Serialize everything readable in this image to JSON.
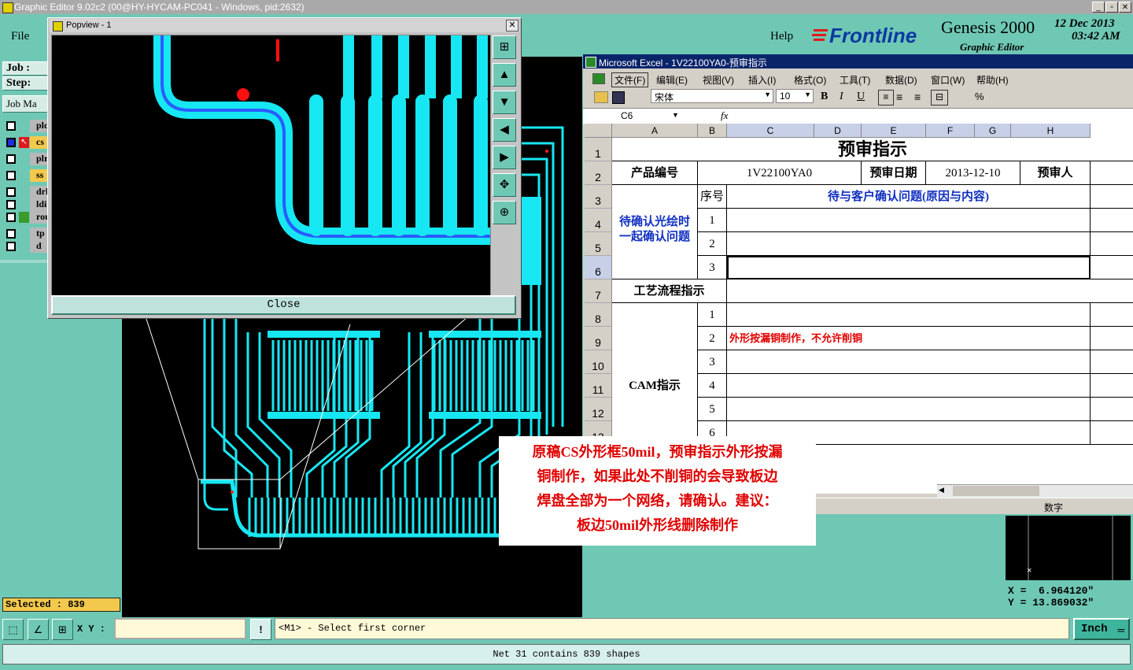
{
  "app": {
    "title": "Graphic Editor 9.02c2 (00@HY-HYCAM-PC041 - Windows, pid:2632)",
    "menu": {
      "file": "File",
      "help": "Help"
    },
    "brand": {
      "logo": "Frontline",
      "product": "Genesis 2000",
      "subtitle": "Graphic Editor",
      "date": "12 Dec 2013",
      "time": "03:42 AM"
    }
  },
  "left_panel": {
    "job_label": "Job :",
    "step_label": "Step:",
    "job_matrix_label": "Job Ma",
    "layers": [
      {
        "name": "plc",
        "color": "#b8b8b8"
      },
      {
        "name": "cs",
        "color": "#f3c94d"
      },
      {
        "name": "plr",
        "color": "#b8b8b8"
      },
      {
        "name": "ss",
        "color": "#f3c94d"
      },
      {
        "name": "drl",
        "color": "#b8b8b8"
      },
      {
        "name": "ldi",
        "color": "#b8b8b8"
      },
      {
        "name": "rou",
        "color": "#b8b8b8"
      },
      {
        "name": "tp",
        "color": "#b8b8b8"
      },
      {
        "name": "d",
        "color": "#b8b8b8"
      }
    ],
    "selected": "Selected : 839"
  },
  "popview": {
    "title": "Popview - 1",
    "close": "Close"
  },
  "excel": {
    "title": "Microsoft Excel - 1V22100YA0-预审指示",
    "menus": [
      "文件(F)",
      "编辑(E)",
      "视图(V)",
      "插入(I)",
      "格式(O)",
      "工具(T)",
      "数据(D)",
      "窗口(W)",
      "帮助(H)"
    ],
    "font": "宋体",
    "size": "10",
    "cell_ref": "C6",
    "fx": "fx",
    "columns": [
      "A",
      "B",
      "C",
      "D",
      "E",
      "F",
      "G",
      "H"
    ],
    "rows": [
      "1",
      "2",
      "3",
      "4",
      "5",
      "6",
      "7",
      "8",
      "9",
      "10",
      "11",
      "12",
      "13"
    ],
    "sheet": {
      "title": "预审指示",
      "product_label": "产品编号",
      "product_no": "1V22100YA0",
      "date_label": "预审日期",
      "date": "2013-12-10",
      "reviewer_label": "预审人",
      "seq_label": "序号",
      "issue_header": "待与客户确认问题(原因与内容)",
      "confirm_label_1": "待确认光绘时",
      "confirm_label_2": "一起确认问题",
      "process_label": "工艺流程指示",
      "cam_label": "CAM指示",
      "cam_item_2": "外形按漏铜制作，不允许削铜",
      "nums": [
        "1",
        "2",
        "3",
        "4",
        "5",
        "6"
      ]
    },
    "status_num": "数字"
  },
  "note": {
    "lines": [
      "原稿CS外形框50mil，预审指示外形按漏",
      "铜制作，如果此处不削铜的会导致板边",
      "焊盘全部为一个网络，请确认。建议：",
      "板边50mil外形线删除制作"
    ]
  },
  "coords": {
    "x": "X =  6.964120\"",
    "y": "Y = 13.869032\""
  },
  "bottom": {
    "xy_label": "X Y :",
    "exclaim": "!",
    "prompt": "<M1> - Select first corner",
    "unit": "Inch",
    "status": "Net 31 contains 839 shapes"
  }
}
